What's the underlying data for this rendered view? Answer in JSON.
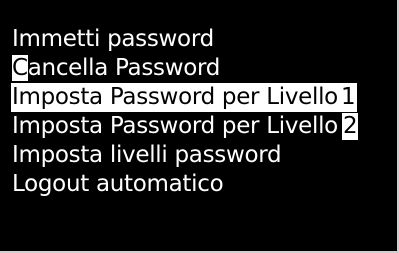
{
  "menu": {
    "items": [
      {
        "label": "Immetti password"
      },
      {
        "cursor_char": "C",
        "label_rest": "ancella Password"
      },
      {
        "label": "Imposta Password per Livello ",
        "level": "1",
        "selected": true
      },
      {
        "label": "Imposta Password per Livello ",
        "level": "2"
      },
      {
        "label": "Imposta livelli password"
      },
      {
        "label": "Logout automatico"
      }
    ]
  },
  "colors": {
    "background": "#000000",
    "text": "#ffffff",
    "highlight": "#ffffff"
  }
}
